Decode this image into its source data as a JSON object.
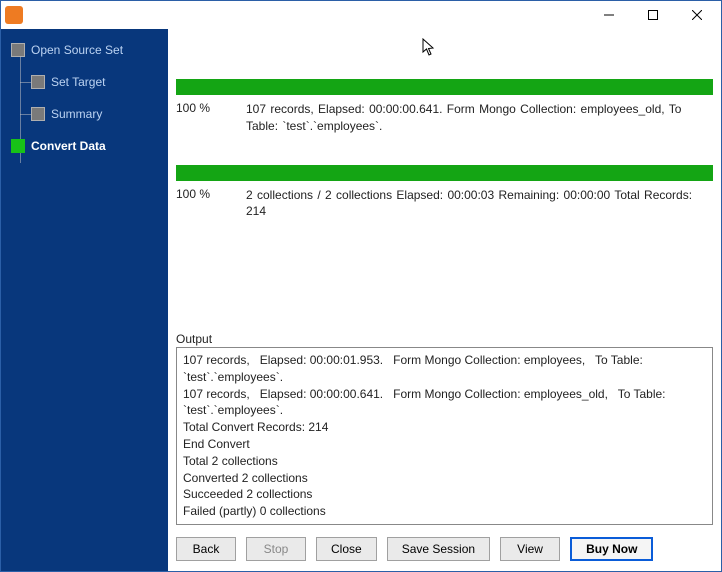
{
  "titlebar": {
    "title": ""
  },
  "sidebar": {
    "items": [
      {
        "label": "Open Source Set"
      },
      {
        "label": "Set Target"
      },
      {
        "label": "Summary"
      },
      {
        "label": "Convert Data"
      }
    ],
    "active_index": 3
  },
  "progress": [
    {
      "percent": "100 %",
      "text": "107 records,   Elapsed: 00:00:00.641.   Form Mongo Collection: employees_old,   To Table: `test`.`employees`."
    },
    {
      "percent": "100 %",
      "text": "2 collections / 2 collections   Elapsed: 00:00:03   Remaining: 00:00:00   Total Records: 214"
    }
  ],
  "output": {
    "label": "Output",
    "lines": [
      "107 records,   Elapsed: 00:00:01.953.   Form Mongo Collection: employees,   To Table: `test`.`employees`.",
      "107 records,   Elapsed: 00:00:00.641.   Form Mongo Collection: employees_old,   To Table: `test`.`employees`.",
      "Total Convert Records: 214",
      "End Convert",
      "Total 2 collections",
      "Converted 2 collections",
      "Succeeded 2 collections",
      "Failed (partly) 0 collections"
    ]
  },
  "buttons": {
    "back": "Back",
    "stop": "Stop",
    "close": "Close",
    "save": "Save Session",
    "view": "View",
    "buy": "Buy Now"
  }
}
